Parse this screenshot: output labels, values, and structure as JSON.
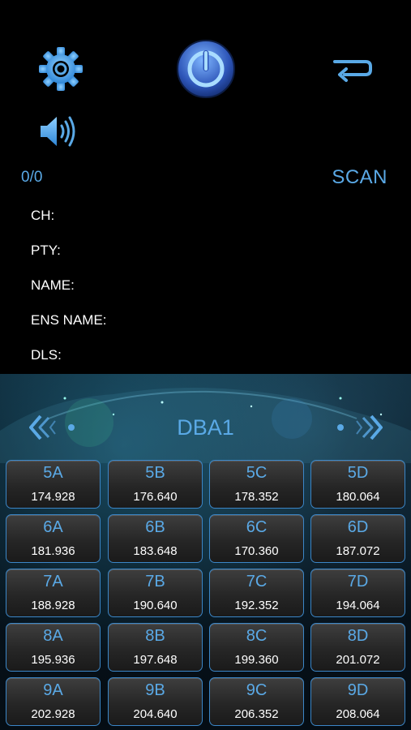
{
  "toolbar": {
    "settings_icon": "gear-icon",
    "power_icon": "power-icon",
    "back_icon": "return-icon",
    "volume_icon": "speaker-icon"
  },
  "status": {
    "counter": "0/0",
    "scan_label": "SCAN"
  },
  "info": [
    {
      "label": "CH:"
    },
    {
      "label": "PTY:"
    },
    {
      "label": "NAME:"
    },
    {
      "label": "ENS NAME:"
    },
    {
      "label": "DLS:"
    }
  ],
  "band": {
    "title": "DBA1"
  },
  "channels": [
    [
      {
        "label": "5A",
        "freq": "174.928"
      },
      {
        "label": "5B",
        "freq": "176.640"
      },
      {
        "label": "5C",
        "freq": "178.352"
      },
      {
        "label": "5D",
        "freq": "180.064"
      }
    ],
    [
      {
        "label": "6A",
        "freq": "181.936"
      },
      {
        "label": "6B",
        "freq": "183.648"
      },
      {
        "label": "6C",
        "freq": "170.360"
      },
      {
        "label": "6D",
        "freq": "187.072"
      }
    ],
    [
      {
        "label": "7A",
        "freq": "188.928"
      },
      {
        "label": "7B",
        "freq": "190.640"
      },
      {
        "label": "7C",
        "freq": "192.352"
      },
      {
        "label": "7D",
        "freq": "194.064"
      }
    ],
    [
      {
        "label": "8A",
        "freq": "195.936"
      },
      {
        "label": "8B",
        "freq": "197.648"
      },
      {
        "label": "8C",
        "freq": "199.360"
      },
      {
        "label": "8D",
        "freq": "201.072"
      }
    ],
    [
      {
        "label": "9A",
        "freq": "202.928"
      },
      {
        "label": "9B",
        "freq": "204.640"
      },
      {
        "label": "9C",
        "freq": "206.352"
      },
      {
        "label": "9D",
        "freq": "208.064"
      }
    ]
  ],
  "colors": {
    "accent": "#5aa9e6",
    "background": "#000000",
    "cell_border": "#3b86c7"
  }
}
